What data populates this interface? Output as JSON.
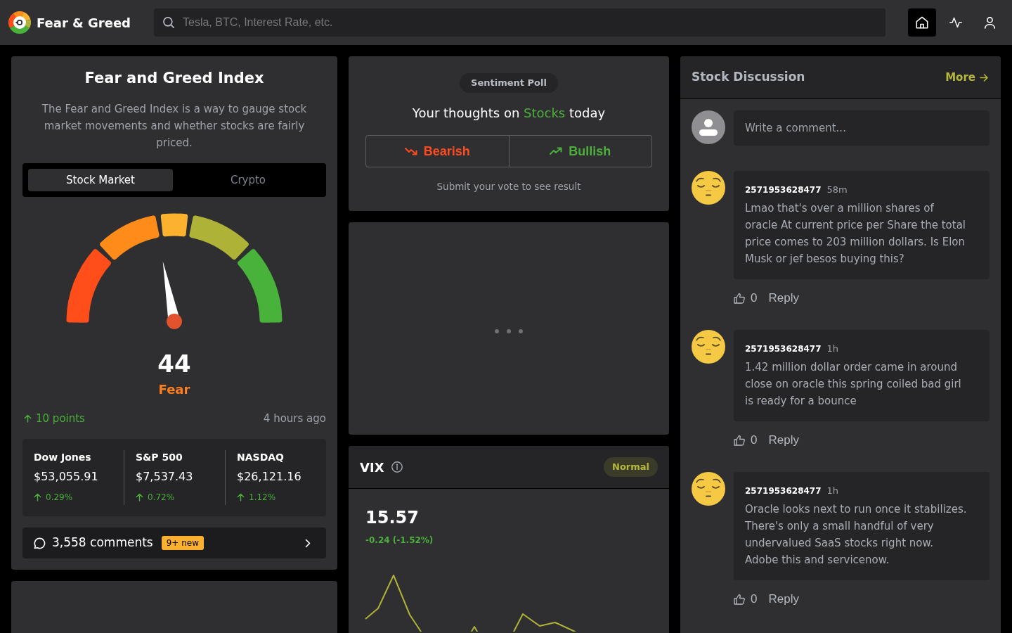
{
  "header": {
    "logo_text": "Fear & Greed",
    "search": {
      "placeholder": "Tesla, BTC, Interest Rate, etc."
    },
    "nav": [
      {
        "kind": "home",
        "selected": true
      },
      {
        "kind": "activity",
        "selected": false
      },
      {
        "kind": "account",
        "selected": false
      }
    ]
  },
  "index_card": {
    "title": "Fear and Greed Index",
    "description": "The Fear and Greed Index is a way to gauge stock market movements and whether stocks are fairly priced.",
    "tabs": [
      {
        "label": "Stock Market",
        "selected": true
      },
      {
        "label": "Crypto",
        "selected": false
      }
    ],
    "gauge": {
      "level": 0.44
    },
    "score": "44",
    "rating": "Fear",
    "change": "10 points",
    "updated": "4 hours ago",
    "markets": [
      {
        "name": "Dow Jones",
        "value": "$53,055.91",
        "change": "0.29%"
      },
      {
        "name": "S&P 500",
        "value": "$7,537.43",
        "change": "0.72%"
      },
      {
        "name": "NASDAQ",
        "value": "$26,121.16",
        "change": "1.12%"
      }
    ],
    "comments": {
      "count": "3,558 comments",
      "badge": "9+ new"
    }
  },
  "poll": {
    "label": "Sentiment Poll",
    "question": {
      "before": "Your thoughts on",
      "topic": "Stocks",
      "after": "today"
    },
    "options": [
      {
        "kind": "bearish",
        "label": "Bearish"
      },
      {
        "kind": "bullish",
        "label": "Bullish"
      }
    ],
    "note": "Submit your vote to see result"
  },
  "vix": {
    "title": "VIX",
    "status": "Normal",
    "value": "15.57",
    "change": "-0.24 (-1.52%)"
  },
  "discussion": {
    "title": "Stock Discussion",
    "more": "More",
    "comment_placeholder": "Write a comment...",
    "comments": [
      {
        "user": "2571953628477",
        "time": "58m",
        "text": "Lmao that's over a million shares of oracle At current price per Share the total price comes to 203 million dollars. Is Elon Musk or jef besos buying this?",
        "likes": "0",
        "reply": "Reply"
      },
      {
        "user": "2571953628477",
        "time": "1h",
        "text": "1.42 million dollar order came in around close on oracle this spring coiled bad girl is ready for a bounce",
        "likes": "0",
        "reply": "Reply"
      },
      {
        "user": "2571953628477",
        "time": "1h",
        "text": "Oracle looks next to run once it stabilizes. There's only a small handful of very undervalued SaaS stocks right now. Adobe this and servicenow.",
        "likes": "0",
        "reply": "Reply"
      }
    ]
  }
}
